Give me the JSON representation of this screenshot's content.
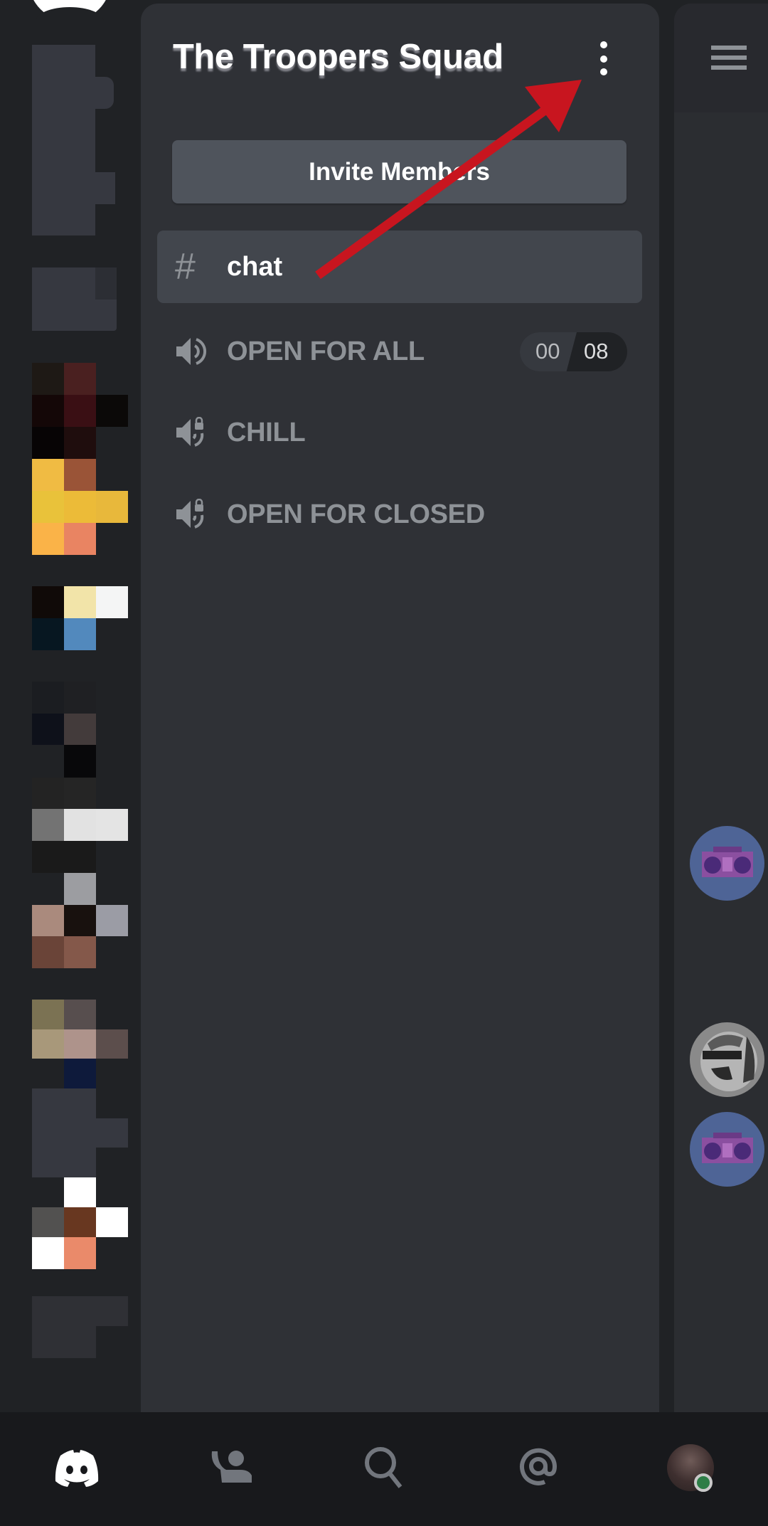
{
  "server": {
    "title": "The Troopers Squad",
    "invite_label": "Invite Members"
  },
  "channels": {
    "text": [
      {
        "icon": "hash-icon",
        "name": "chat",
        "active": true
      }
    ],
    "voice": [
      {
        "icon": "speaker-icon",
        "name": "OPEN FOR ALL",
        "locked": false,
        "badge": {
          "connected": "00",
          "limit": "08"
        }
      },
      {
        "icon": "speaker-lock-icon",
        "name": "CHILL",
        "locked": true
      },
      {
        "icon": "speaker-lock-icon",
        "name": "OPEN FOR CLOSED",
        "locked": true
      }
    ]
  },
  "bottom_nav": [
    {
      "name": "home",
      "icon": "discord-logo-icon",
      "active": true
    },
    {
      "name": "friends",
      "icon": "friends-wave-icon",
      "active": false
    },
    {
      "name": "search",
      "icon": "search-icon",
      "active": false
    },
    {
      "name": "mentions",
      "icon": "at-sign-icon",
      "active": false
    },
    {
      "name": "profile",
      "icon": "user-avatar",
      "status": "online"
    }
  ],
  "members_preview": [
    {
      "avatar": "boombox-avatar"
    },
    {
      "avatar": "bear-avatar"
    },
    {
      "avatar": "boombox-avatar"
    }
  ],
  "server_icons_pixelated": [
    [
      "#1e1915",
      "#4a2020",
      null
    ],
    [
      "#140707",
      "#3a0f14",
      "#0b0908"
    ],
    [
      "#070405",
      "#1f0d0d",
      null
    ],
    [
      "#f0bb43",
      "#9a5437",
      null
    ],
    [
      "#e9c23a",
      "#ecbb38",
      "#e8b83b"
    ],
    [
      "#fab348",
      "#e98462",
      null
    ],
    [
      "#100a08",
      "#f2e4a9",
      "#f4f5f5"
    ],
    [
      "#071721",
      "#5289bd",
      null
    ],
    [
      "#1b1d21",
      "#1f2023",
      null
    ],
    [
      "#0e111a",
      "#433b3b",
      null
    ],
    [
      null,
      "#08080a",
      null
    ],
    [
      "#232323",
      "#252525",
      null
    ],
    [
      "#737373",
      "#e2e2e2",
      "#e4e4e4"
    ],
    [
      "#1a1a1a",
      "#1a1a1a",
      null
    ],
    [
      null,
      "#9c9da1",
      null
    ],
    [
      "#aa8a7d",
      "#18110e",
      "#9b9ca5"
    ],
    [
      "#6a4438",
      "#84584a",
      null
    ],
    [
      "#7b7253",
      "#574e4e",
      null
    ],
    [
      "#a8987a",
      "#ae938b",
      "#5c4e4c"
    ],
    [
      null,
      "#0e1a3b",
      null
    ],
    [
      "#363840",
      "#363840",
      null
    ],
    [
      "#363840",
      "#363840",
      "#363840"
    ],
    [
      "#363840",
      "#363840",
      null
    ],
    [
      null,
      "#ffffff",
      null
    ],
    [
      "#525150",
      "#683720",
      "#ffffff"
    ],
    [
      "#ffffff",
      "#ea8a6a",
      null
    ],
    [
      "#2f3035",
      "#2f3035",
      "#2f3035"
    ],
    [
      "#2f3035",
      "#2f3035",
      null
    ]
  ],
  "colors": {
    "annotation_arrow": "#c8151f",
    "online_status": "#2d7d46"
  }
}
